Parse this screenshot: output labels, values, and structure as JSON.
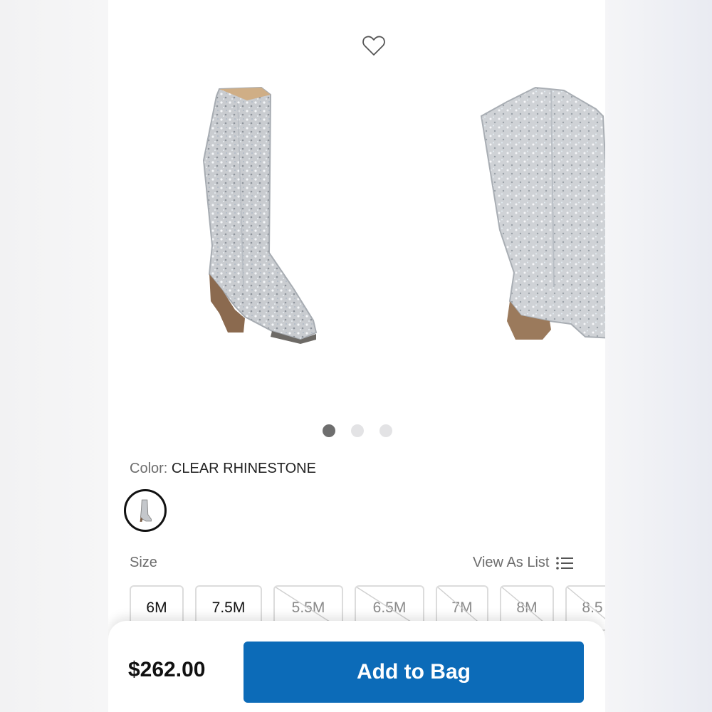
{
  "product": {
    "favorite_icon": "heart-icon",
    "images": [
      "boot-side-view",
      "boot-angle-view"
    ],
    "carousel": {
      "count": 3,
      "active_index": 0
    }
  },
  "color": {
    "label": "Color:",
    "value": "CLEAR RHINESTONE"
  },
  "size": {
    "label": "Size",
    "view_as_list": "View As List",
    "view_icon": "list-icon",
    "options": [
      {
        "label": "6M",
        "available": true
      },
      {
        "label": "7.5M",
        "available": true
      },
      {
        "label": "5.5M",
        "available": false
      },
      {
        "label": "6.5M",
        "available": false
      },
      {
        "label": "7M",
        "available": false
      },
      {
        "label": "8M",
        "available": false
      },
      {
        "label": "8.5",
        "available": false
      }
    ]
  },
  "purchase": {
    "price": "$262.00",
    "add_to_bag": "Add to Bag"
  },
  "colors": {
    "accent": "#0c6bb8",
    "dot_active": "#6e6e6e",
    "dot_inactive": "#e3e3e5"
  }
}
